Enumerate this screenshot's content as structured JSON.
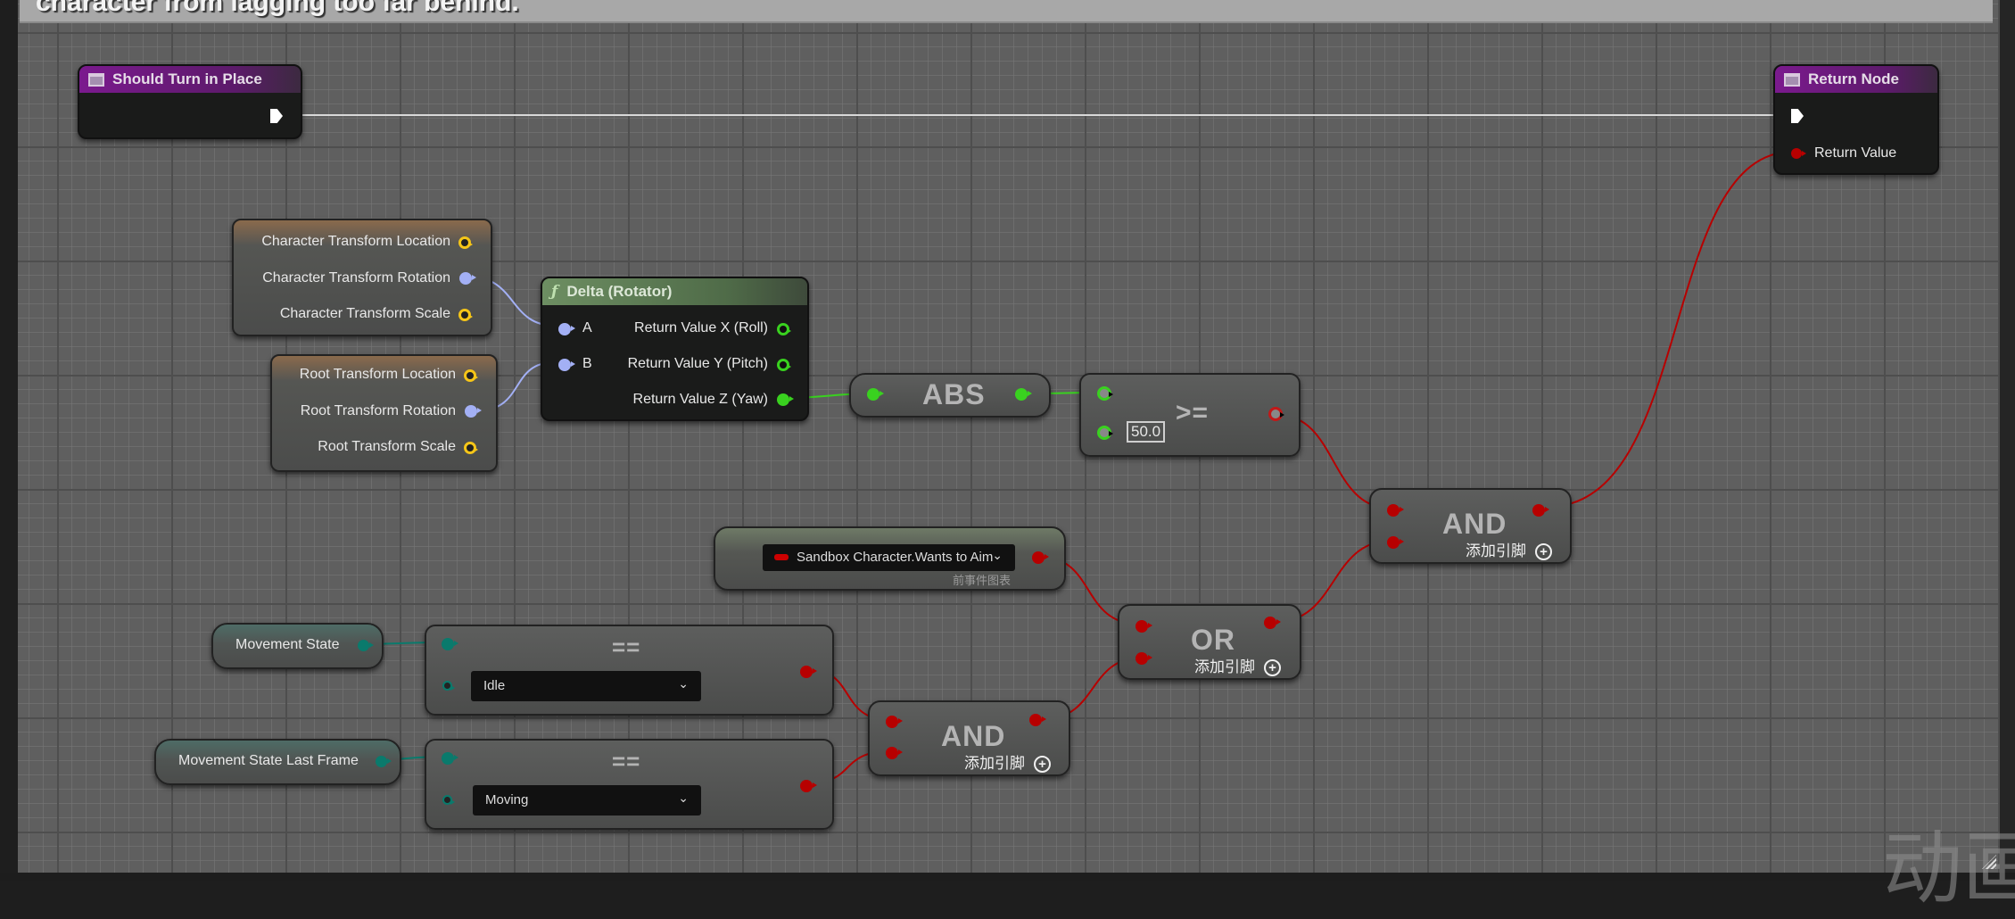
{
  "comment": {
    "text": "character from lagging too far behind."
  },
  "nodes": {
    "should_turn": {
      "title": "Should Turn in Place",
      "icon": "function-entry-icon"
    },
    "return_node": {
      "title": "Return Node",
      "pins": {
        "return_value": "Return Value"
      }
    },
    "char_transform": {
      "pins": [
        "Character Transform Location",
        "Character Transform Rotation",
        "Character Transform Scale"
      ]
    },
    "root_transform": {
      "pins": [
        "Root Transform Location",
        "Root Transform Rotation",
        "Root Transform Scale"
      ]
    },
    "delta": {
      "title": "Delta (Rotator)",
      "inputs": [
        "A",
        "B"
      ],
      "outputs": [
        "Return Value X (Roll)",
        "Return Value Y (Pitch)",
        "Return Value Z (Yaw)"
      ]
    },
    "abs": {
      "label": "ABS"
    },
    "gte": {
      "label": ">=",
      "value": "50.0"
    },
    "wants_to_aim": {
      "value": "Sandbox Character.Wants to Aim",
      "subtitle": "前事件图表"
    },
    "and_top": {
      "label": "AND",
      "add_pin": "添加引脚"
    },
    "or": {
      "label": "OR",
      "add_pin": "添加引脚"
    },
    "movement_state": {
      "label": "Movement State"
    },
    "eq_idle": {
      "label": "==",
      "value": "Idle"
    },
    "movement_state_last": {
      "label": "Movement State Last Frame"
    },
    "eq_moving": {
      "label": "==",
      "value": "Moving"
    },
    "and_bottom": {
      "label": "AND",
      "add_pin": "添加引脚"
    }
  },
  "watermark": "动画",
  "colors": {
    "exec": "#ffffff",
    "bool": "#b70000",
    "float": "#39d11f",
    "rotator": "#a3b0f5",
    "vector": "#f5c518",
    "enum": "#0a7a6c",
    "function_header": "#5c7a52",
    "event_header": "#7b1a8e"
  }
}
